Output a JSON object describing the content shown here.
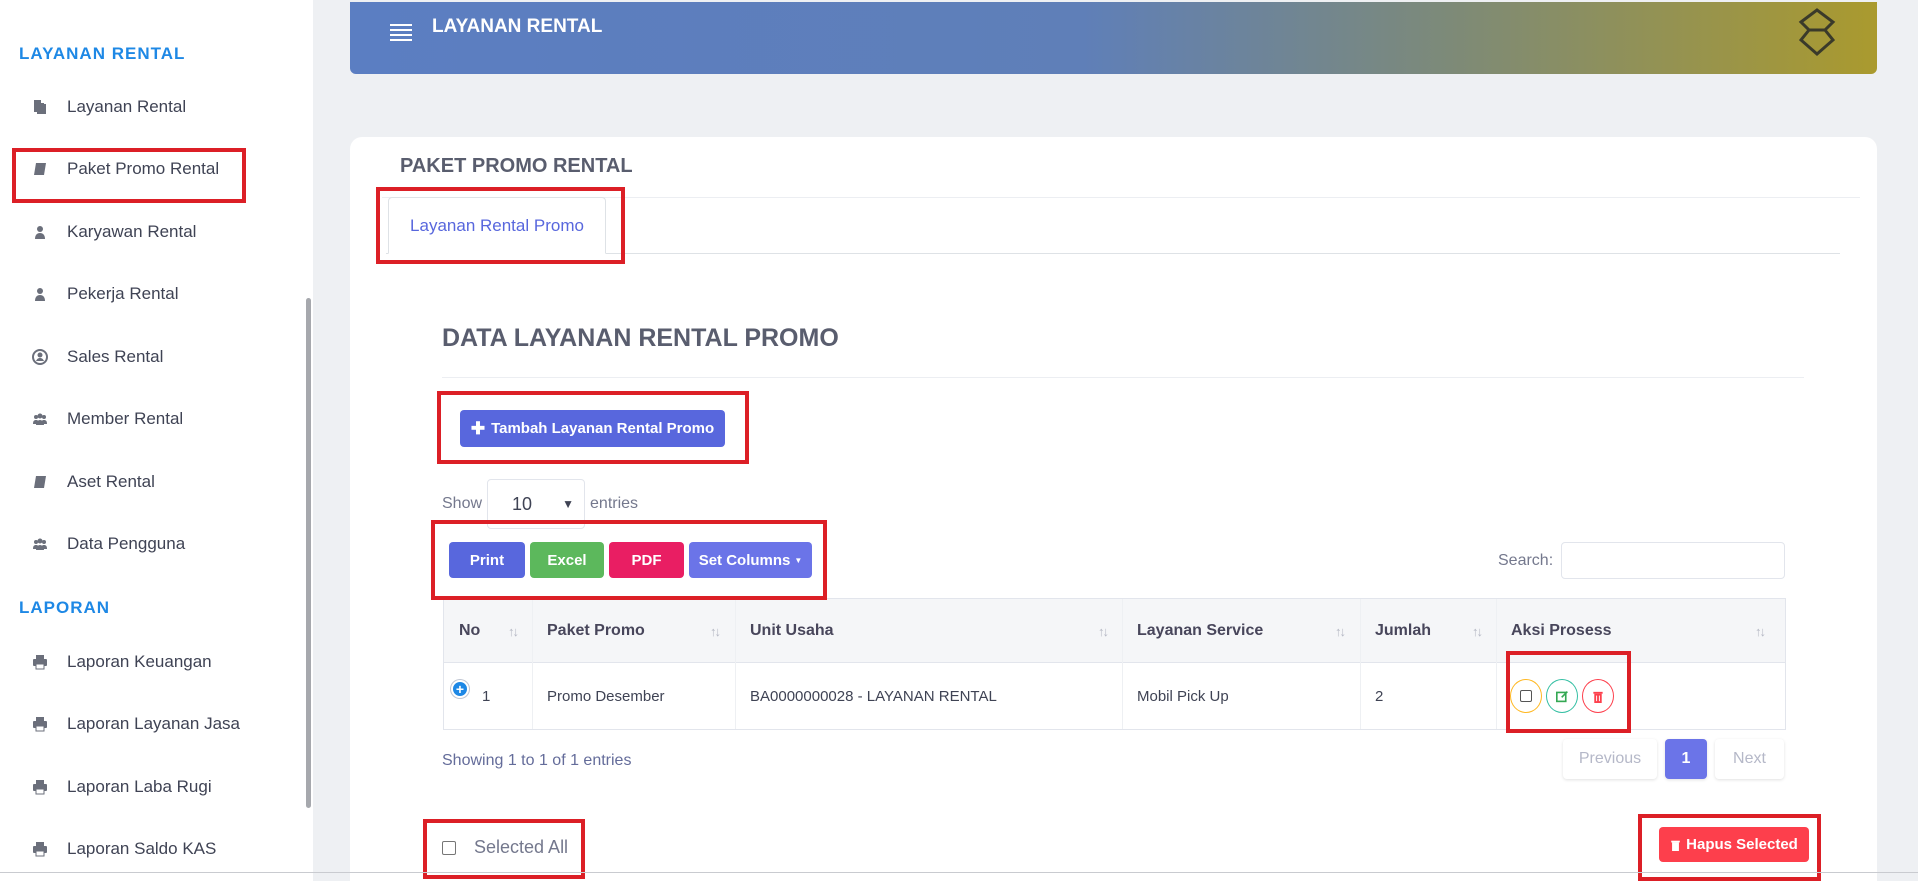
{
  "sidebar": {
    "section_layanan": "LAYANAN RENTAL",
    "section_laporan": "LAPORAN",
    "items": [
      {
        "label": "Layanan Rental",
        "icon": "copy-icon"
      },
      {
        "label": "Paket Promo Rental",
        "icon": "book-icon"
      },
      {
        "label": "Karyawan Rental",
        "icon": "user-secret-icon"
      },
      {
        "label": "Pekerja Rental",
        "icon": "user-icon"
      },
      {
        "label": "Sales Rental",
        "icon": "user-circle-icon"
      },
      {
        "label": "Member Rental",
        "icon": "users-icon"
      },
      {
        "label": "Aset Rental",
        "icon": "book-icon"
      },
      {
        "label": "Data Pengguna",
        "icon": "users-icon"
      }
    ],
    "reports": [
      {
        "label": "Laporan Keuangan",
        "icon": "print-icon"
      },
      {
        "label": "Laporan Layanan Jasa",
        "icon": "print-icon"
      },
      {
        "label": "Laporan Laba Rugi",
        "icon": "print-icon"
      },
      {
        "label": "Laporan Saldo KAS",
        "icon": "print-icon"
      }
    ]
  },
  "header": {
    "title": "LAYANAN RENTAL"
  },
  "card": {
    "title": "PAKET PROMO RENTAL",
    "tab": "Layanan Rental Promo",
    "section_title": "DATA LAYANAN RENTAL PROMO",
    "add_button": "Tambah Layanan Rental Promo"
  },
  "datatable": {
    "show_label": "Show",
    "entries_label": "entries",
    "page_length": "10",
    "buttons": {
      "print": "Print",
      "excel": "Excel",
      "pdf": "PDF",
      "columns": "Set Columns"
    },
    "search_label": "Search:",
    "columns": [
      "No",
      "Paket Promo",
      "Unit Usaha",
      "Layanan Service",
      "Jumlah",
      "Aksi Prosess"
    ],
    "rows": [
      {
        "no": "1",
        "paket_promo": "Promo Desember",
        "unit_usaha": "BA0000000028 - LAYANAN RENTAL",
        "layanan_service": "Mobil Pick Up",
        "jumlah": "2"
      }
    ],
    "info": "Showing 1 to 1 of 1 entries",
    "pagination": {
      "previous": "Previous",
      "current": "1",
      "next": "Next"
    }
  },
  "footer": {
    "select_all": "Selected All",
    "delete_selected": "Hapus Selected"
  },
  "colors": {
    "primary": "#5867dd",
    "success": "#5cb85c",
    "danger": "#e91e63",
    "highlight": "#dc1f26",
    "brand_blue": "#1e88e5"
  }
}
